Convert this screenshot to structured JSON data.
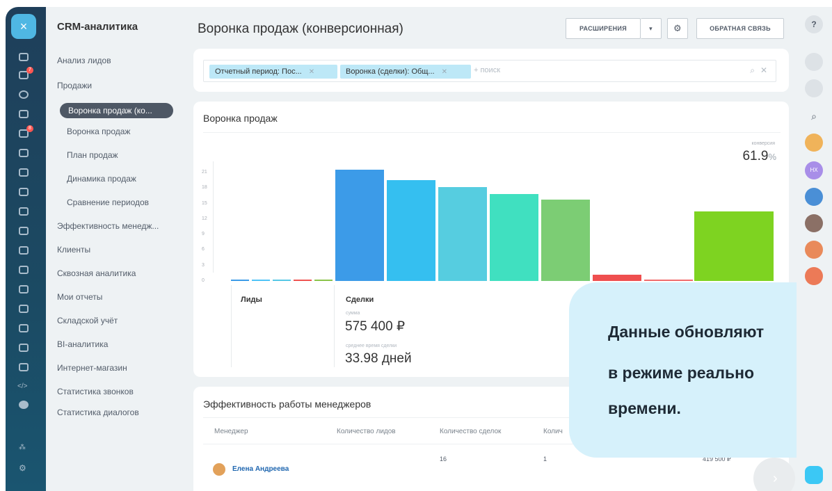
{
  "app": {
    "title": "CRM-аналитика"
  },
  "nav": {
    "items": [
      "Анализ лидов",
      "Продажи"
    ],
    "active": "Воронка продаж (ко...",
    "sub_items": [
      "Воронка продаж",
      "План продаж",
      "Динамика продаж",
      "Сравнение периодов"
    ],
    "items_after": [
      "Эффективность менедж...",
      "Клиенты",
      "Сквозная аналитика",
      "Мои отчеты",
      "Складской учёт",
      "BI-аналитика",
      "Интернет-магазин",
      "Статистика звонков",
      "Статистика диалогов"
    ]
  },
  "header": {
    "title": "Воронка продаж (конверсионная)",
    "extensions": "РАСШИРЕНИЯ",
    "feedback": "ОБРАТНАЯ СВЯЗЬ"
  },
  "filter": {
    "chips": [
      "Отчетный период: Пос...",
      "Воронка (сделки): Общ..."
    ],
    "placeholder": "+ поиск"
  },
  "funnel": {
    "title": "Воронка продаж",
    "conversion_label": "конверсия",
    "conversion_value": "61.9",
    "conversion_unit": "%",
    "leads_label": "Лиды",
    "deals_label": "Сделки",
    "sum_label": "сумма",
    "sum_value": "575 400 ₽",
    "avg_time_label": "среднее время сделки",
    "avg_time_value": "33.98 дней"
  },
  "chart_data": {
    "type": "bar",
    "y_ticks": [
      "21",
      "18",
      "15",
      "12",
      "9",
      "6",
      "3",
      "0"
    ],
    "ylim": [
      0,
      21
    ],
    "groups": [
      {
        "name": "Лиды",
        "values": [
          0.3,
          0.3,
          0.3,
          0.3,
          0.3
        ],
        "colors": [
          "#3c9be8",
          "#4fc3f7",
          "#56c7e6",
          "#ef5350",
          "#8bc34a"
        ]
      },
      {
        "name": "Сделки",
        "values": [
          21.5,
          19.5,
          18.2,
          16.8,
          15.8,
          1.2,
          0.3,
          13.5
        ],
        "colors": [
          "#3c9be8",
          "#35bff0",
          "#56cde0",
          "#40e0c0",
          "#7ccd74",
          "#ef4f4f",
          "#f06b6b",
          "#7ed321"
        ]
      }
    ]
  },
  "managers": {
    "title": "Эффективность работы менеджеров",
    "columns": [
      "Менеджер",
      "Количество лидов",
      "Количество сделок",
      "Колич"
    ],
    "rows": [
      {
        "name": "Елена Андреева",
        "leads": "",
        "deals": "16",
        "other": "1",
        "sum": "419 500 ₽"
      }
    ]
  },
  "bubble": {
    "lines": [
      "Данные обновляют",
      "в режиме реально",
      "времени."
    ]
  },
  "right_rail": {
    "avatar_initials": "HX"
  },
  "colors": {
    "accent": "#4fb7e3",
    "chip": "#bde8f7",
    "bubble": "#d6f1fb"
  }
}
